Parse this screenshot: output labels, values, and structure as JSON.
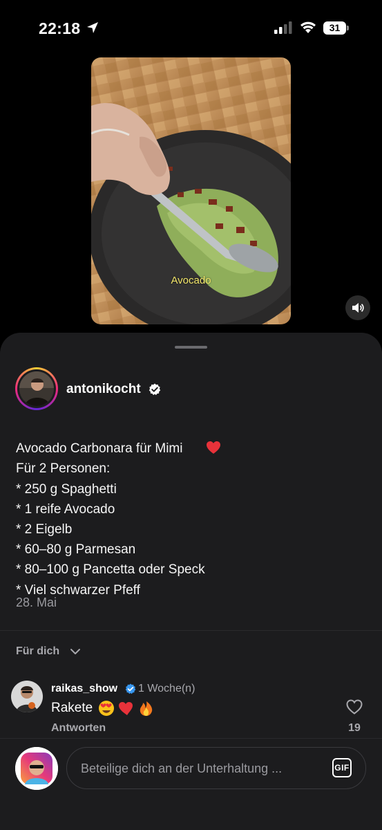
{
  "status_bar": {
    "time": "22:18",
    "battery": "31",
    "icons": [
      "location-arrow-icon",
      "signal-icon",
      "wifi-icon",
      "battery-icon"
    ]
  },
  "video": {
    "caption_overlay": "Avocado",
    "sound_icon": "speaker-icon"
  },
  "post": {
    "username": "antonikocht",
    "verified": true,
    "caption_lines": [
      "Avocado Carbonara für Mimi",
      "Für 2 Personen:",
      "* 250 g Spaghetti",
      "* 1 reife Avocado",
      "* 2 Eigelb",
      "* 60–80 g Parmesan",
      "* 80–100 g Pancetta oder Speck",
      "* Viel schwarzer Pfeff"
    ],
    "caption_emoji": "❤️",
    "date": "28. Mai"
  },
  "comments_section": {
    "filter_label": "Für dich",
    "comments": [
      {
        "username": "raikas_show",
        "verified": true,
        "time": "1 Woche(n)",
        "text": "Rakete",
        "emojis": [
          "heart-eyes-emoji",
          "red-heart-emoji",
          "fire-emoji"
        ],
        "reply_label": "Antworten",
        "likes": "19"
      }
    ]
  },
  "composer": {
    "placeholder": "Beteilige dich an der Unterhaltung ...",
    "gif_label": "GIF"
  },
  "colors": {
    "background": "#000000",
    "sheet": "#1c1c1e",
    "verified_blue": "#3897f0",
    "secondary_text": "#a8a8ad"
  }
}
